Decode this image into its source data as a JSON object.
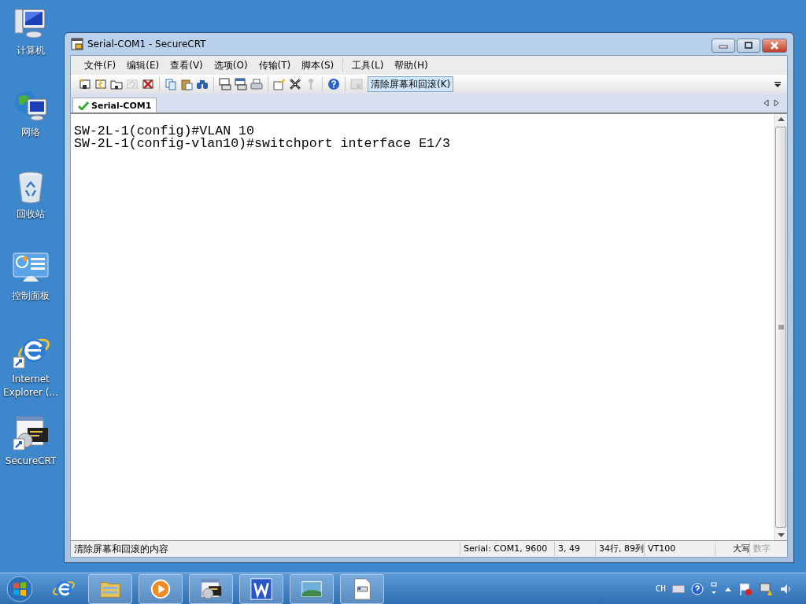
{
  "desktop_icons": [
    {
      "label": "计算机",
      "kind": "computer"
    },
    {
      "label": "网络",
      "kind": "network"
    },
    {
      "label": "回收站",
      "kind": "recycle"
    },
    {
      "label": "控制面板",
      "kind": "control"
    },
    {
      "label": "Internet Explorer (...",
      "kind": "ie"
    },
    {
      "label": "SecureCRT",
      "kind": "crt"
    }
  ],
  "window": {
    "title": "Serial-COM1 - SecureCRT",
    "menu": [
      "文件(F)",
      "编辑(E)",
      "查看(V)",
      "选项(O)",
      "传输(T)",
      "脚本(S)",
      "工具(L)",
      "帮助(H)"
    ],
    "toolbar": [
      [
        {
          "kind": "connect",
          "disabled": false
        },
        {
          "kind": "quick",
          "disabled": false
        },
        {
          "kind": "tab",
          "disabled": false
        },
        {
          "kind": "reconnect",
          "disabled": true
        },
        {
          "kind": "disconnect",
          "disabled": false
        }
      ],
      [
        {
          "kind": "copy",
          "disabled": false
        },
        {
          "kind": "paste",
          "disabled": false
        },
        {
          "kind": "find",
          "disabled": false
        }
      ],
      [
        {
          "kind": "print",
          "disabled": false
        },
        {
          "kind": "print-select",
          "disabled": false
        },
        {
          "kind": "printer",
          "disabled": false
        }
      ],
      [
        {
          "kind": "options",
          "disabled": false
        },
        {
          "kind": "map",
          "disabled": false
        },
        {
          "kind": "key",
          "disabled": true
        }
      ],
      [
        {
          "kind": "help",
          "disabled": false
        }
      ],
      [
        {
          "kind": "screen",
          "disabled": true
        }
      ]
    ],
    "clear_button": "清除屏幕和回滚(K)",
    "tabs": [
      {
        "label": "Serial-COM1",
        "selected": true
      }
    ],
    "terminal_lines": [
      "SW-2L-1(config)#VLAN 10",
      "SW-2L-1(config-vlan10)#switchport interface E1/3"
    ],
    "status_bar": [
      {
        "text": "清除屏幕和回滚的内容",
        "disabled": false
      },
      {
        "text": "Serial: COM1, 9600",
        "disabled": false
      },
      {
        "text": "3,  49",
        "disabled": false
      },
      {
        "text": "34行, 89列",
        "disabled": false
      },
      {
        "text": "VT100",
        "disabled": false
      },
      {
        "text": "大写",
        "disabled": false
      },
      {
        "text": "数字",
        "disabled": true
      }
    ]
  },
  "taskbar": {
    "items": [
      {
        "kind": "ie"
      },
      {
        "kind": "explorer"
      },
      {
        "kind": "media"
      },
      {
        "kind": "crt"
      },
      {
        "kind": "wps"
      },
      {
        "kind": "photo"
      },
      {
        "kind": "doc"
      }
    ],
    "language": "CH"
  }
}
